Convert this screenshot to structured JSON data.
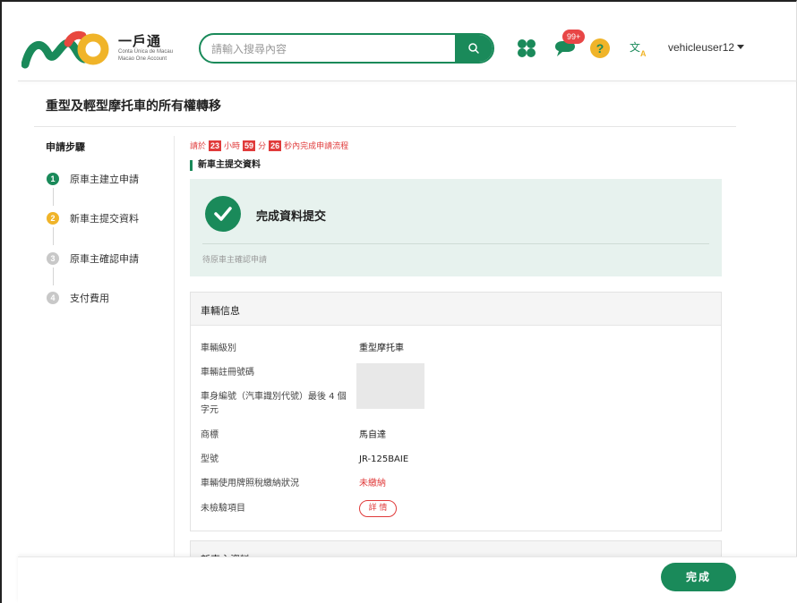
{
  "header": {
    "logo_cn": "一戶通",
    "logo_pt": "Conta Única de Macau",
    "logo_en": "Macao One Account",
    "search_placeholder": "請輸入搜尋內容",
    "notification_badge": "99+",
    "username": "vehicleuser12",
    "lang_icon_text": "文A"
  },
  "page": {
    "title": "重型及輕型摩托車的所有權轉移"
  },
  "steps": {
    "heading": "申請步驟",
    "items": [
      {
        "num": "1",
        "label": "原車主建立申請",
        "color": "#1a8a5a"
      },
      {
        "num": "2",
        "label": "新車主提交資料",
        "color": "#f0b429"
      },
      {
        "num": "3",
        "label": "原車主確認申請",
        "color": "#c8c8c8"
      },
      {
        "num": "4",
        "label": "支付費用",
        "color": "#c8c8c8"
      }
    ]
  },
  "countdown": {
    "prefix": "請於",
    "hours": "23",
    "hours_unit": "小時",
    "minutes": "59",
    "minutes_unit": "分",
    "seconds": "26",
    "suffix": "秒內完成申請流程"
  },
  "section": {
    "label": "新車主提交資料"
  },
  "success": {
    "title": "完成資料提交",
    "subtitle": "待原車主確認申請"
  },
  "vehicle": {
    "heading": "車輛信息",
    "rows": [
      {
        "label": "車輛級別",
        "value": "重型摩托車"
      },
      {
        "label": "車輛註冊號碼",
        "value": ""
      },
      {
        "label": "車身編號（汽車識別代號）最後 4 個字元",
        "value": ""
      },
      {
        "label": "商標",
        "value": "馬自達"
      },
      {
        "label": "型號",
        "value": "JR-125BAIE"
      },
      {
        "label": "車輛使用牌照稅繳納狀況",
        "value": "未繳納"
      },
      {
        "label": "未檢驗項目",
        "value": "詳 情"
      }
    ]
  },
  "next_section": {
    "heading": "新車主資料"
  },
  "footer": {
    "done_label": "完成"
  },
  "colors": {
    "primary": "#1a8a5a",
    "danger": "#e03b3b",
    "warning": "#f0b429"
  }
}
